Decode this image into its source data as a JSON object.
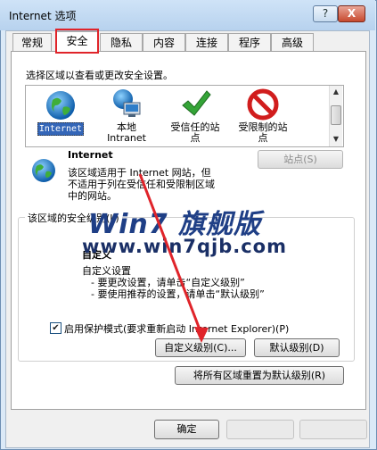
{
  "window": {
    "title": "Internet 选项",
    "help_label": "?",
    "close_label": "X"
  },
  "tabs": [
    "常规",
    "安全",
    "隐私",
    "内容",
    "连接",
    "程序",
    "高级"
  ],
  "security": {
    "instruction": "选择区域以查看或更改安全设置。",
    "zones": [
      {
        "label": "Internet",
        "icon": "globe-icon"
      },
      {
        "label": "本地\nIntranet",
        "label_line1": "本地",
        "label_line2": "Intranet",
        "icon": "intranet-icon"
      },
      {
        "label_line1": "受信任的站",
        "label_line2": "点",
        "icon": "check-icon"
      },
      {
        "label_line1": "受限制的站",
        "label_line2": "点",
        "icon": "restricted-icon"
      }
    ],
    "zone_name": "Internet",
    "zone_desc_1": "该区域适用于 Internet 网站，但",
    "zone_desc_2": "不适用于列在受信任和受限制区域",
    "zone_desc_3": "中的网站。",
    "sites_button": "站点(S)",
    "level_title": "该区域的安全级别(L)",
    "custom_title": "自定义",
    "custom_line1": "自定义设置",
    "custom_line2": "- 要更改设置，请单击“自定义级别”",
    "custom_line3": "- 要使用推荐的设置，请单击“默认级别”",
    "protected_mode_label": "启用保护模式(要求重新启动 Internet Explorer)(P)",
    "protected_mode_checked": true,
    "custom_level_button": "自定义级别(C)...",
    "default_level_button": "默认级别(D)",
    "reset_all_button": "将所有区域重置为默认级别(R)"
  },
  "watermark": {
    "logo": "Win7 旗舰版",
    "url": "www.win7qjb.com"
  },
  "footer": {
    "ok_button": "确定"
  },
  "colors": {
    "highlight_red": "#e0242a",
    "title_bar": "#b7d2ee",
    "selected_zone": "#3466b8"
  }
}
